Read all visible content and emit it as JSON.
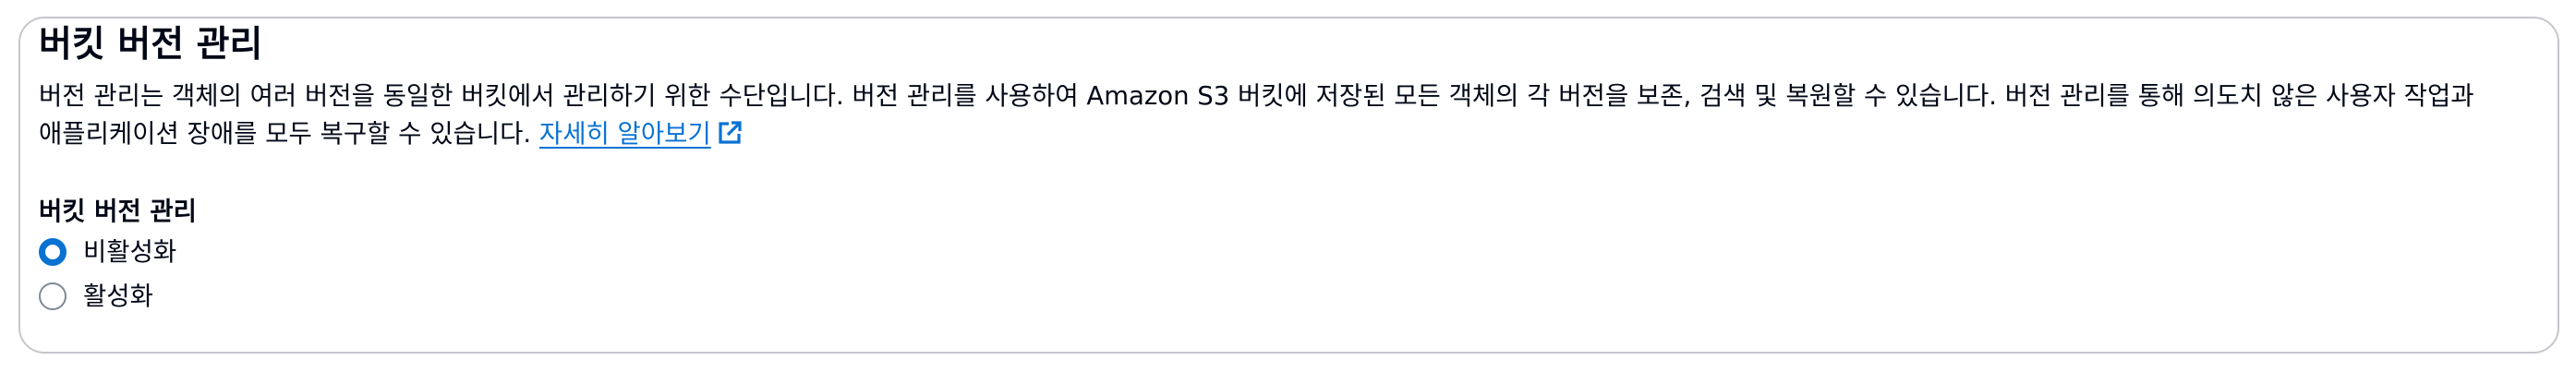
{
  "section": {
    "title": "버킷 버전 관리",
    "description": "버전 관리는 객체의 여러 버전을 동일한 버킷에서 관리하기 위한 수단입니다. 버전 관리를 사용하여 Amazon S3 버킷에 저장된 모든 객체의 각 버전을 보존, 검색 및 복원할 수 있습니다. 버전 관리를 통해 의도치 않은 사용자 작업과 애플리케이션 장애를 모두 복구할 수 있습니다.",
    "learn_more_link": "자세히 알아보기",
    "learn_more_icon": "external-link-icon"
  },
  "versioning": {
    "label": "버킷 버전 관리",
    "options": [
      {
        "label": "비활성화",
        "selected": true
      },
      {
        "label": "활성화",
        "selected": false
      }
    ]
  },
  "colors": {
    "accent": "#0972d3",
    "border": "#c6c6cd",
    "text": "#000716"
  }
}
